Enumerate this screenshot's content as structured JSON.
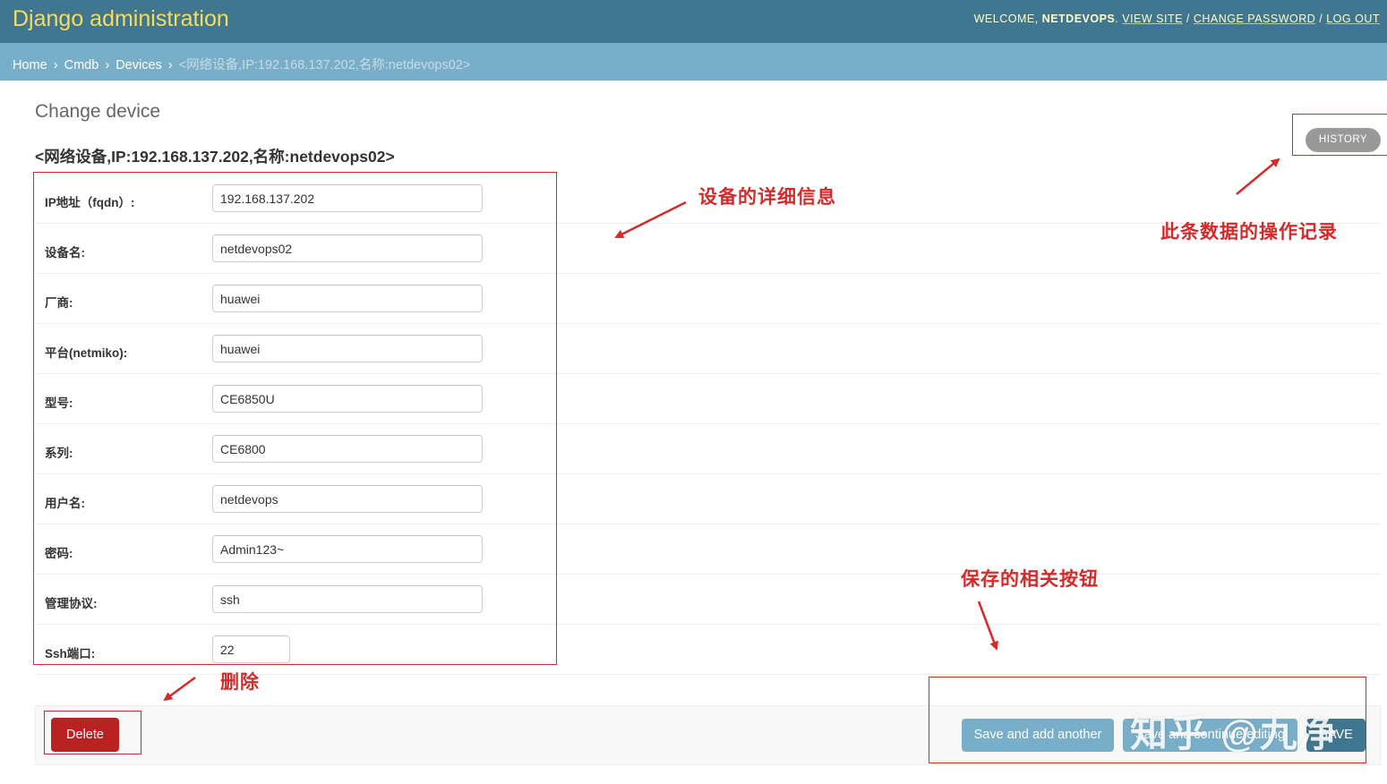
{
  "header": {
    "site_name": "Django administration",
    "welcome_prefix": "WELCOME, ",
    "username": "NETDEVOPS",
    "view_site": "VIEW SITE",
    "change_password": "CHANGE PASSWORD",
    "log_out": "LOG OUT",
    "separator": " / "
  },
  "breadcrumbs": {
    "home": "Home",
    "app": "Cmdb",
    "model": "Devices",
    "current": "<网络设备,IP:192.168.137.202,名称:netdevops02>",
    "separator": "›"
  },
  "page_title": "Change device",
  "object_title": "<网络设备,IP:192.168.137.202,名称:netdevops02>",
  "history_label": "HISTORY",
  "fields": [
    {
      "label": "IP地址（fqdn）:",
      "value": "192.168.137.202"
    },
    {
      "label": "设备名:",
      "value": "netdevops02"
    },
    {
      "label": "厂商:",
      "value": "huawei"
    },
    {
      "label": "平台(netmiko):",
      "value": "huawei"
    },
    {
      "label": "型号:",
      "value": "CE6850U"
    },
    {
      "label": "系列:",
      "value": "CE6800"
    },
    {
      "label": "用户名:",
      "value": "netdevops"
    },
    {
      "label": "密码:",
      "value": "Admin123~"
    },
    {
      "label": "管理协议:",
      "value": "ssh"
    },
    {
      "label": "Ssh端口:",
      "value": "22"
    }
  ],
  "submit_row": {
    "delete": "Delete",
    "save_add_another": "Save and add another",
    "save_continue": "Save and continue editing",
    "save": "SAVE"
  },
  "annotations": {
    "details": "设备的详细信息",
    "history": "此条数据的操作记录",
    "save_buttons": "保存的相关按钮",
    "delete": "删除"
  },
  "watermark": "知乎 @九净",
  "colors": {
    "header_bg": "#417690",
    "breadcrumbs_bg": "#79aec8",
    "brand_text": "#f5dd5d",
    "delete_bg": "#ba2121",
    "annotation_red": "#d42a2a"
  }
}
